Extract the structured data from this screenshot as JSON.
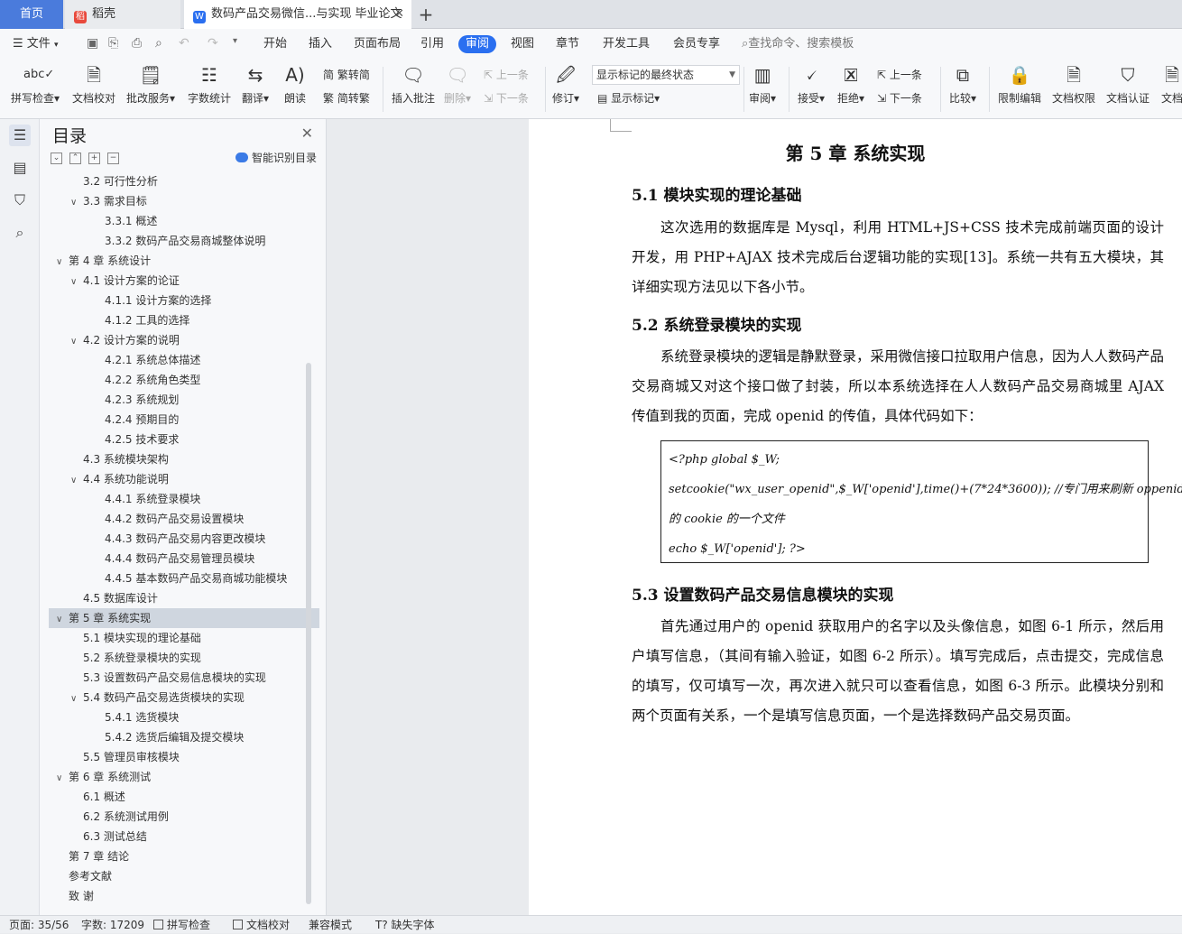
{
  "tabs": {
    "home": "首页",
    "daoke": "稻壳",
    "doc": "数码产品交易微信...与实现 毕业论文",
    "new_tab": "+"
  },
  "menu": {
    "file": "文件",
    "items": [
      "开始",
      "插入",
      "页面布局",
      "引用",
      "审阅",
      "视图",
      "章节",
      "开发工具",
      "会员专享"
    ],
    "active": "审阅",
    "search": "查找命令、搜索模板"
  },
  "ribbon": {
    "spell": "拼写检查",
    "doc_check": "文档校对",
    "review_service": "批改服务",
    "word_count": "字数统计",
    "translate": "翻译",
    "read_aloud": "朗读",
    "trad": "繁转简",
    "simp": "简转繁",
    "insert_comment": "插入批注",
    "delete": "删除",
    "prev": "上一条",
    "next": "下一条",
    "revise": "修订",
    "markup_select": "显示标记的最终状态",
    "show_markup": "显示标记",
    "review": "审阅",
    "accept": "接受",
    "reject": "拒绝",
    "prev2": "上一条",
    "next2": "下一条",
    "compare": "比较",
    "restrict": "限制编辑",
    "doc_rights": "文档权限",
    "doc_cert": "文档认证",
    "doc_more": "文档"
  },
  "toc": {
    "title": "目录",
    "smart": "智能识别目录",
    "items": [
      {
        "level": 2,
        "text": "3.2  可行性分析",
        "caret": ""
      },
      {
        "level": 2,
        "text": "3.3  需求目标",
        "caret": "v"
      },
      {
        "level": 3,
        "text": "3.3.1  概述",
        "caret": ""
      },
      {
        "level": 3,
        "text": "3.3.2  数码产品交易商城整体说明",
        "caret": ""
      },
      {
        "level": 1,
        "text": "第 4 章  系统设计",
        "caret": "v"
      },
      {
        "level": 2,
        "text": "4.1  设计方案的论证",
        "caret": "v"
      },
      {
        "level": 3,
        "text": "4.1.1  设计方案的选择",
        "caret": ""
      },
      {
        "level": 3,
        "text": "4.1.2  工具的选择",
        "caret": ""
      },
      {
        "level": 2,
        "text": "4.2  设计方案的说明",
        "caret": "v"
      },
      {
        "level": 3,
        "text": "4.2.1  系统总体描述",
        "caret": ""
      },
      {
        "level": 3,
        "text": "4.2.2  系统角色类型",
        "caret": ""
      },
      {
        "level": 3,
        "text": "4.2.3  系统规划",
        "caret": ""
      },
      {
        "level": 3,
        "text": "4.2.4  预期目的",
        "caret": ""
      },
      {
        "level": 3,
        "text": "4.2.5  技术要求",
        "caret": ""
      },
      {
        "level": 2,
        "text": "4.3  系统模块架构",
        "caret": ""
      },
      {
        "level": 2,
        "text": "4.4  系统功能说明",
        "caret": "v"
      },
      {
        "level": 3,
        "text": "4.4.1  系统登录模块",
        "caret": ""
      },
      {
        "level": 3,
        "text": "4.4.2  数码产品交易设置模块",
        "caret": ""
      },
      {
        "level": 3,
        "text": "4.4.3  数码产品交易内容更改模块",
        "caret": ""
      },
      {
        "level": 3,
        "text": "4.4.4  数码产品交易管理员模块",
        "caret": ""
      },
      {
        "level": 3,
        "text": "4.4.5  基本数码产品交易商城功能模块",
        "caret": ""
      },
      {
        "level": 2,
        "text": "4.5  数据库设计",
        "caret": ""
      },
      {
        "level": 1,
        "text": "第 5 章  系统实现",
        "caret": "v",
        "highlight": true
      },
      {
        "level": 2,
        "text": "5.1  模块实现的理论基础",
        "caret": ""
      },
      {
        "level": 2,
        "text": "5.2  系统登录模块的实现",
        "caret": ""
      },
      {
        "level": 2,
        "text": "5.3  设置数码产品交易信息模块的实现",
        "caret": ""
      },
      {
        "level": 2,
        "text": "5.4  数码产品交易选货模块的实现",
        "caret": "v"
      },
      {
        "level": 3,
        "text": "5.4.1  选货模块",
        "caret": ""
      },
      {
        "level": 3,
        "text": "5.4.2  选货后编辑及提交模块",
        "caret": ""
      },
      {
        "level": 2,
        "text": "5.5  管理员审核模块",
        "caret": ""
      },
      {
        "level": 1,
        "text": "第 6 章  系统测试",
        "caret": "v"
      },
      {
        "level": 2,
        "text": "6.1  概述",
        "caret": ""
      },
      {
        "level": 2,
        "text": "6.2  系统测试用例",
        "caret": ""
      },
      {
        "level": 2,
        "text": "6.3  测试总结",
        "caret": ""
      },
      {
        "level": 1,
        "text": "第 7 章  结论",
        "caret": ""
      },
      {
        "level": 1,
        "text": "参考文献",
        "caret": ""
      },
      {
        "level": 1,
        "text": "致    谢",
        "caret": ""
      }
    ]
  },
  "doc": {
    "chapter": "第 5 章  系统实现",
    "s51_title": "5.1  模块实现的理论基础",
    "s51_para": "这次选用的数据库是 Mysql，利用 HTML+JS+CSS 技术完成前端页面的设计开发，用 PHP+AJAX 技术完成后台逻辑功能的实现[13]。系统一共有五大模块，其详细实现方法见以下各小节。",
    "s52_title": "5.2  系统登录模块的实现",
    "s52_para": "系统登录模块的逻辑是静默登录，采用微信接口拉取用户信息，因为人人数码产品交易商城又对这个接口做了封装，所以本系统选择在人人数码产品交易商城里 AJAX 传值到我的页面，完成 openid 的传值，具体代码如下：",
    "code": [
      "<?php    global $_W;",
      "setcookie(\"wx_user_openid\",$_W['openid'],time()+(7*24*3600)); //专门用来刷新 oppenid",
      "的 cookie 的一个文件",
      "echo $_W['openid'];    ?>"
    ],
    "s53_title": "5.3  设置数码产品交易信息模块的实现",
    "s53_para": "首先通过用户的 openid 获取用户的名字以及头像信息，如图 6-1 所示，然后用户填写信息，（其间有输入验证，如图 6-2 所示）。填写完成后，点击提交，完成信息的填写，仅可填写一次，再次进入就只可以查看信息，如图 6-3 所示。此模块分别和两个页面有关系，一个是填写信息页面，一个是选择数码产品交易页面。"
  },
  "status": {
    "page": "页面: 35/56",
    "words": "字数: 17209",
    "spell": "拼写检查",
    "proof": "文档校对",
    "compat": "兼容模式",
    "missing_font": "缺失字体"
  },
  "colors": {
    "accent": "#2a6ff0",
    "home_tab": "#4a7bdc",
    "toc_highlight": "#cfd6df"
  }
}
